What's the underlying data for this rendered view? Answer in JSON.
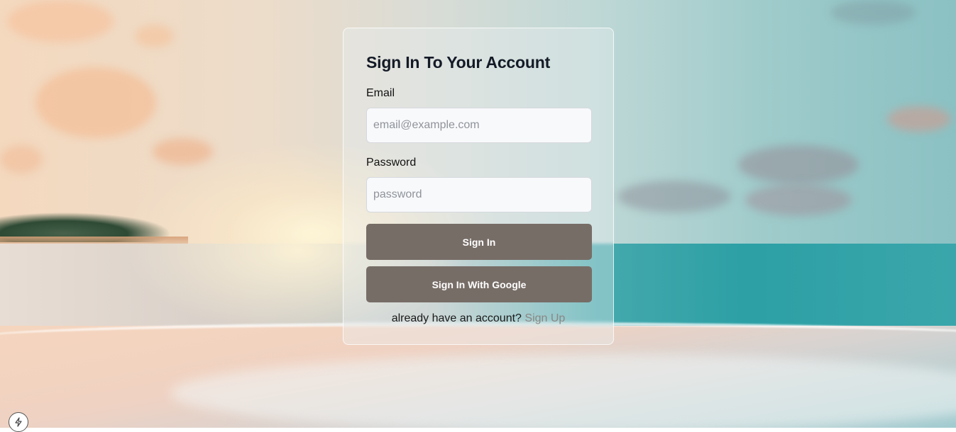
{
  "auth": {
    "title": "Sign In To Your Account",
    "email_label": "Email",
    "email_placeholder": "email@example.com",
    "email_value": "",
    "password_label": "Password",
    "password_placeholder": "password",
    "password_value": "",
    "sign_in_label": "Sign In",
    "google_label": "Sign In With Google",
    "footer_text": "already have an account?",
    "footer_link": "Sign Up"
  },
  "colors": {
    "button_bg": "#776d67",
    "button_text": "#ffffff",
    "title": "#141a26",
    "link": "#8a8683"
  },
  "icons": {
    "corner_badge": "lightning-bolt-icon"
  }
}
